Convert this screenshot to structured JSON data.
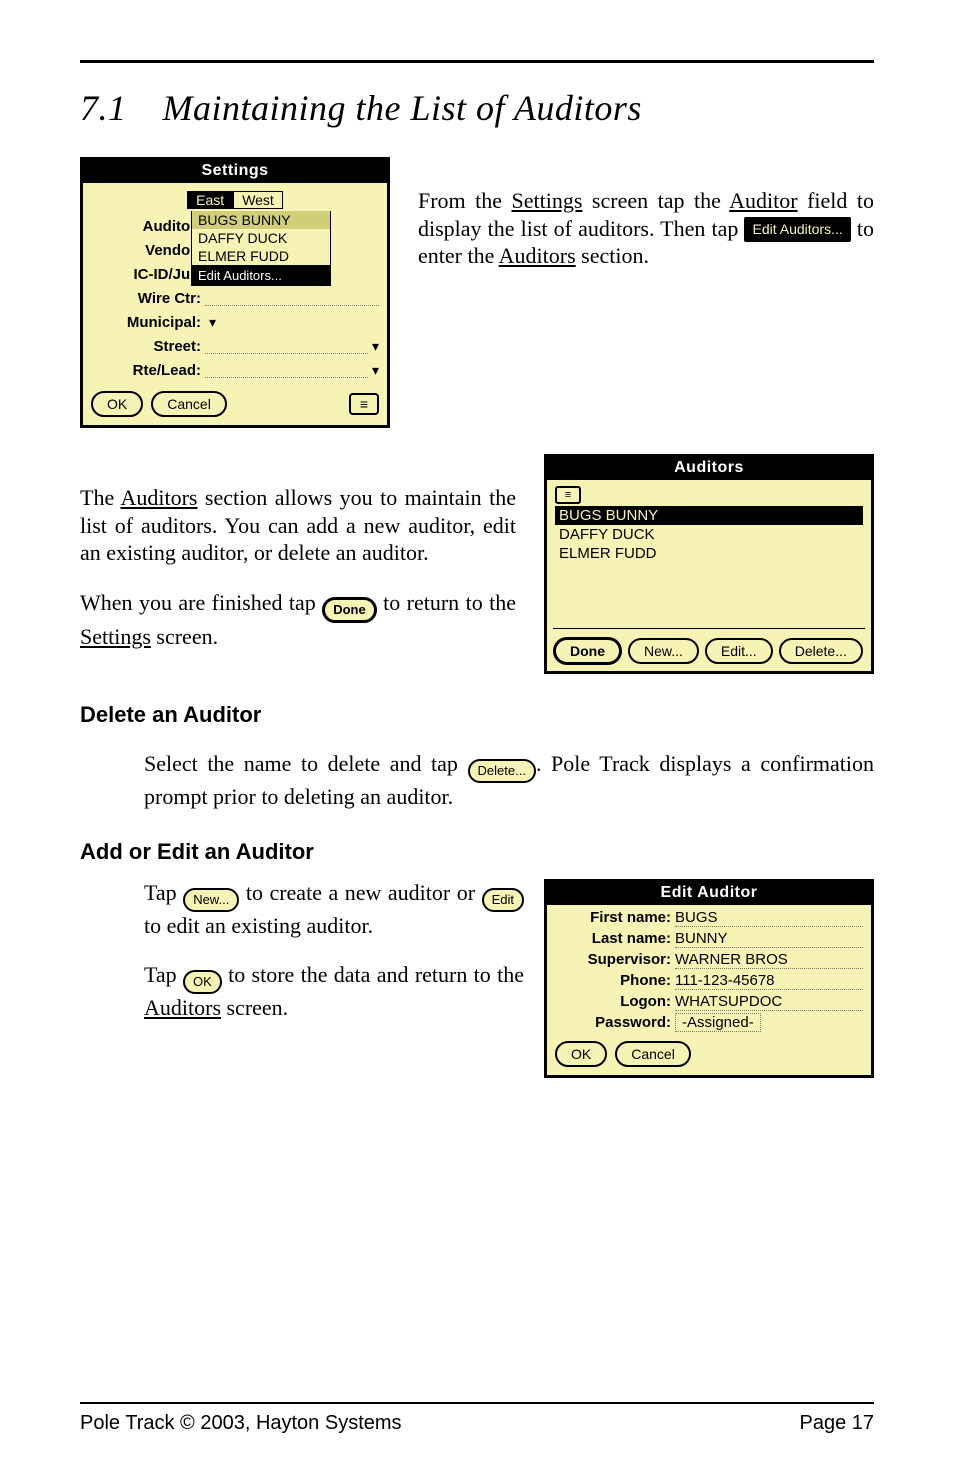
{
  "headings": {
    "section_number": "7.1",
    "section_title": "Maintaining the List of Auditors",
    "delete_heading": "Delete an Auditor",
    "add_edit_heading": "Add or Edit an Auditor"
  },
  "settings_panel": {
    "title": "Settings",
    "tabs": {
      "east": "East",
      "west": "West"
    },
    "labels": {
      "auditor": "Auditor:",
      "vendor": "Vendor:",
      "icidjur": "IC-ID/Jur:",
      "wirectr": "Wire Ctr:",
      "municipal": "Municipal:",
      "street": "Street:",
      "rtelead": "Rte/Lead:"
    },
    "auditor_options": {
      "selected": "BUGS BUNNY",
      "opt2": "DAFFY DUCK",
      "opt3": "ELMER FUDD",
      "edit": "Edit Auditors..."
    },
    "buttons": {
      "ok": "OK",
      "cancel": "Cancel"
    }
  },
  "auditors_panel": {
    "title": "Auditors",
    "list": {
      "item1": "BUGS BUNNY",
      "item2": "DAFFY DUCK",
      "item3": "ELMER FUDD"
    },
    "buttons": {
      "done": "Done",
      "new": "New...",
      "edit": "Edit...",
      "delete": "Delete..."
    }
  },
  "edit_auditor_panel": {
    "title": "Edit Auditor",
    "labels": {
      "first": "First name:",
      "last": "Last name:",
      "supervisor": "Supervisor:",
      "phone": "Phone:",
      "logon": "Logon:",
      "password": "Password:"
    },
    "values": {
      "first": "BUGS",
      "last": "BUNNY",
      "supervisor": "WARNER BROS",
      "phone": "111-123-45678",
      "logon": "WHATSUPDOC",
      "password": "-Assigned-"
    },
    "buttons": {
      "ok": "OK",
      "cancel": "Cancel"
    }
  },
  "inline_chips": {
    "edit_auditors": "Edit Auditors...",
    "done": "Done",
    "delete": "Delete...",
    "new": "New...",
    "edit": "Edit",
    "ok": "OK"
  },
  "body_text": {
    "p1a": "From the ",
    "p1_settings": "Settings",
    "p1b": " screen tap the ",
    "p1_auditor": "Auditor",
    "p1c": " field to display the list of auditors. Then tap ",
    "p1d": " to enter the ",
    "p1_auditors": "Auditors",
    "p1e": " section.",
    "p2a": "The ",
    "p2_auditors": "Auditors",
    "p2b": " section allows you to maintain the list of auditors. You can add a",
    "p2c": " new auditor, edit an existing auditor, or delete an auditor.",
    "p3a": "When you are finished tap ",
    "p3b": " to return to the ",
    "p3_settings": "Settings",
    "p3c": " screen.",
    "del_a": "Select the name to delete and tap ",
    "del_b": ". Pole Track displays a confirmation prompt prior to deleting an auditor.",
    "add_a1": "Tap ",
    "add_a2": " to create a new auditor or ",
    "add_a3": " to edit an existing auditor.",
    "add_b1": "Tap ",
    "add_b2": " to store the data and",
    "add_b3": " return to the ",
    "add_b_auditors": "Auditors",
    "add_b4": " screen."
  },
  "footer": {
    "left": "Pole Track © 2003, Hayton Systems",
    "right": "Page 17"
  }
}
